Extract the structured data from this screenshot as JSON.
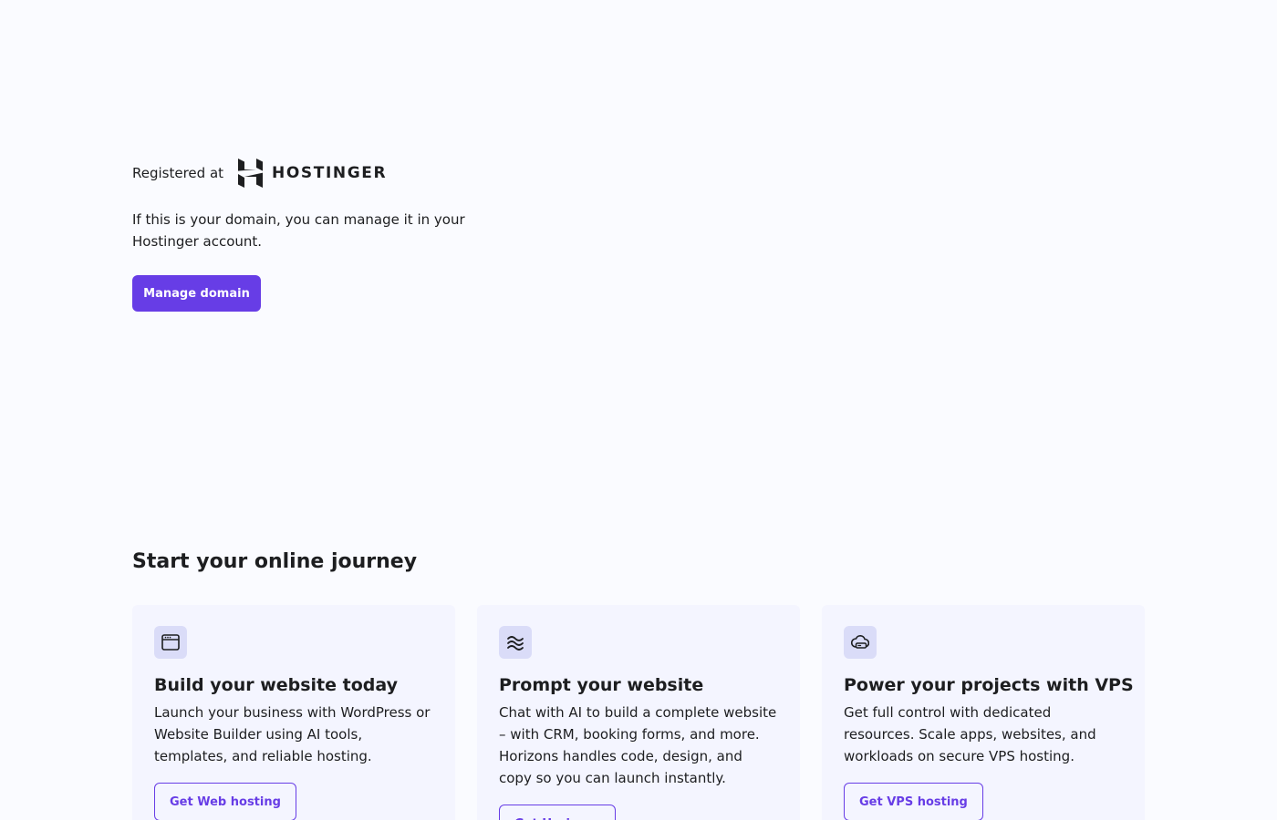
{
  "registration": {
    "label": "Registered at",
    "brand": "HOSTINGER",
    "description": "If this is your domain, you can manage it in your Hostinger account.",
    "button_label": "Manage domain"
  },
  "journey": {
    "title": "Start your online journey",
    "cards": [
      {
        "icon": "browser-window-icon",
        "title": "Build your website today",
        "description": "Launch your business with WordPress or Website Builder using AI tools, templates, and reliable hosting.",
        "button_label": "Get Web hosting"
      },
      {
        "icon": "waves-icon",
        "title": "Prompt your website",
        "description": "Chat with AI to build a complete website – with CRM, booking forms, and more. Horizons handles code, design, and copy so you can launch instantly.",
        "button_label": "Get Horizons"
      },
      {
        "icon": "cloud-server-icon",
        "title": "Power your projects with VPS",
        "description": "Get full control with dedicated resources. Scale apps, websites, and workloads on secure VPS hosting.",
        "button_label": "Get VPS hosting"
      }
    ]
  },
  "colors": {
    "background": "#fafbff",
    "accent": "#673de6",
    "card_background": "#f4f5ff",
    "icon_background": "#dadcf8",
    "text": "#1d1e20"
  }
}
